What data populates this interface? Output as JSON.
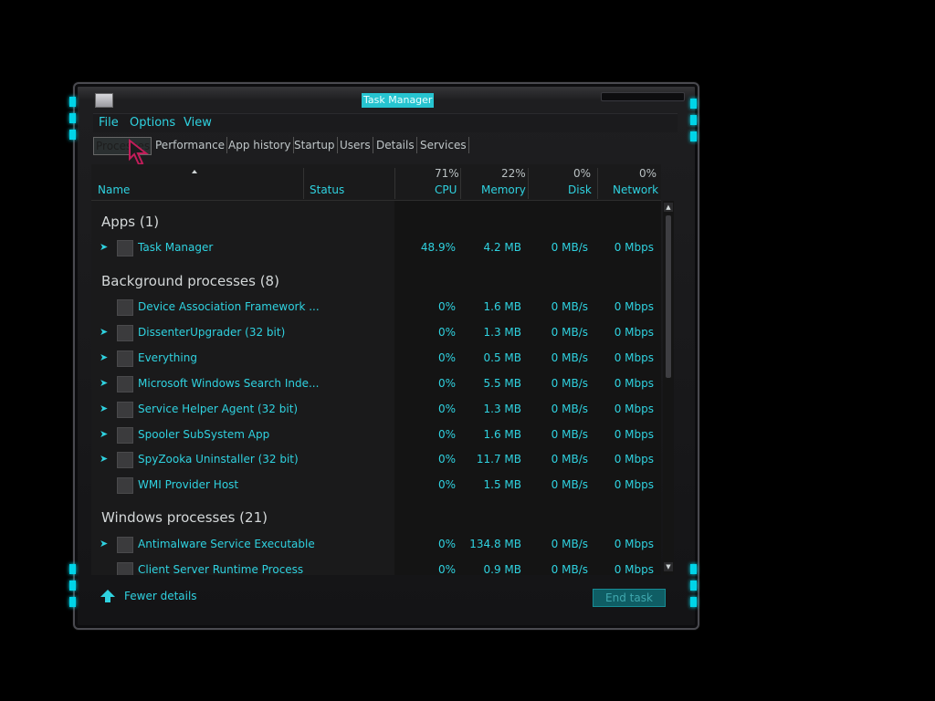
{
  "window": {
    "title": "Task Manager"
  },
  "menu": [
    "File",
    "Options",
    "View"
  ],
  "tabs": [
    "Processes",
    "Performance",
    "App history",
    "Startup",
    "Users",
    "Details",
    "Services"
  ],
  "columns": {
    "name": "Name",
    "status": "Status",
    "cpu": {
      "pct": "71%",
      "label": "CPU"
    },
    "memory": {
      "pct": "22%",
      "label": "Memory"
    },
    "disk": {
      "pct": "0%",
      "label": "Disk"
    },
    "network": {
      "pct": "0%",
      "label": "Network"
    }
  },
  "groups": {
    "apps": "Apps (1)",
    "background": "Background processes (8)",
    "windows": "Windows processes (21)"
  },
  "apps": [
    {
      "name": "Task Manager",
      "cpu": "48.9%",
      "memory": "4.2 MB",
      "disk": "0 MB/s",
      "network": "0 Mbps",
      "expand": true
    }
  ],
  "background": [
    {
      "name": "Device Association Framework ...",
      "cpu": "0%",
      "memory": "1.6 MB",
      "disk": "0 MB/s",
      "network": "0 Mbps",
      "expand": false
    },
    {
      "name": "DissenterUpgrader (32 bit)",
      "cpu": "0%",
      "memory": "1.3 MB",
      "disk": "0 MB/s",
      "network": "0 Mbps",
      "expand": true
    },
    {
      "name": "Everything",
      "cpu": "0%",
      "memory": "0.5 MB",
      "disk": "0 MB/s",
      "network": "0 Mbps",
      "expand": true
    },
    {
      "name": "Microsoft Windows Search Inde...",
      "cpu": "0%",
      "memory": "5.5 MB",
      "disk": "0 MB/s",
      "network": "0 Mbps",
      "expand": true
    },
    {
      "name": "Service Helper Agent (32 bit)",
      "cpu": "0%",
      "memory": "1.3 MB",
      "disk": "0 MB/s",
      "network": "0 Mbps",
      "expand": true
    },
    {
      "name": "Spooler SubSystem App",
      "cpu": "0%",
      "memory": "1.6 MB",
      "disk": "0 MB/s",
      "network": "0 Mbps",
      "expand": true
    },
    {
      "name": "SpyZooka Uninstaller (32 bit)",
      "cpu": "0%",
      "memory": "11.7 MB",
      "disk": "0 MB/s",
      "network": "0 Mbps",
      "expand": true
    },
    {
      "name": "WMI Provider Host",
      "cpu": "0%",
      "memory": "1.5 MB",
      "disk": "0 MB/s",
      "network": "0 Mbps",
      "expand": false
    }
  ],
  "windows": [
    {
      "name": "Antimalware Service Executable",
      "cpu": "0%",
      "memory": "134.8 MB",
      "disk": "0 MB/s",
      "network": "0 Mbps",
      "expand": true
    },
    {
      "name": "Client Server Runtime Process",
      "cpu": "0%",
      "memory": "0.9 MB",
      "disk": "0 MB/s",
      "network": "0 Mbps",
      "expand": false
    }
  ],
  "footer": {
    "fewer_details": "Fewer details",
    "end_task": "End task"
  },
  "colors": {
    "accent": "#2fd2e0",
    "background": "#1a1a1b"
  }
}
